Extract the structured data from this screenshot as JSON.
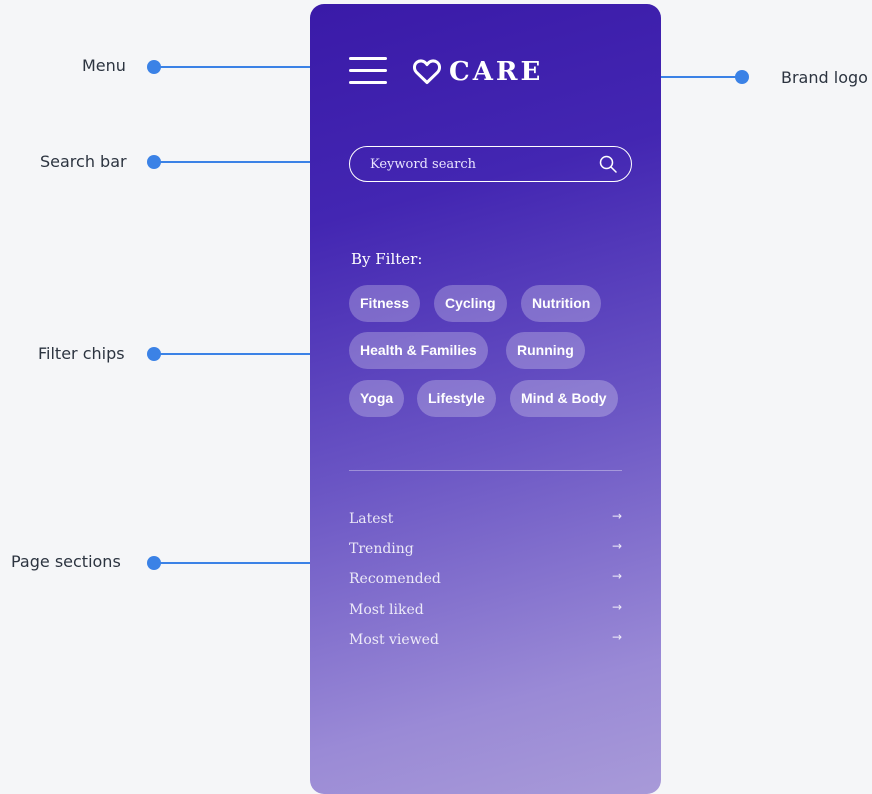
{
  "callouts": {
    "menu": "Menu",
    "search": "Search bar",
    "filters": "Filter chips",
    "sections": "Page sections",
    "brand": "Brand logo"
  },
  "app": {
    "brand": "CARE"
  },
  "search": {
    "placeholder": "Keyword search"
  },
  "filters": {
    "title": "By Filter:",
    "chips": [
      "Fitness",
      "Cycling",
      "Nutrition",
      "Health & Families",
      "Running",
      "Yoga",
      "Lifestyle",
      "Mind & Body"
    ]
  },
  "sections": [
    {
      "label": "Latest",
      "arrow": "→"
    },
    {
      "label": "Trending",
      "arrow": "→"
    },
    {
      "label": "Recomended",
      "arrow": "→"
    },
    {
      "label": "Most liked",
      "arrow": "→"
    },
    {
      "label": "Most viewed",
      "arrow": "→"
    }
  ],
  "colors": {
    "accent": "#3b82e6",
    "gradient_top": "#3a1aa8",
    "gradient_bottom": "#a89ad8"
  },
  "icons": {
    "menu": "hamburger-menu-icon",
    "brand": "heart-icon",
    "search": "search-icon",
    "section_arrow": "arrow-right-icon"
  }
}
